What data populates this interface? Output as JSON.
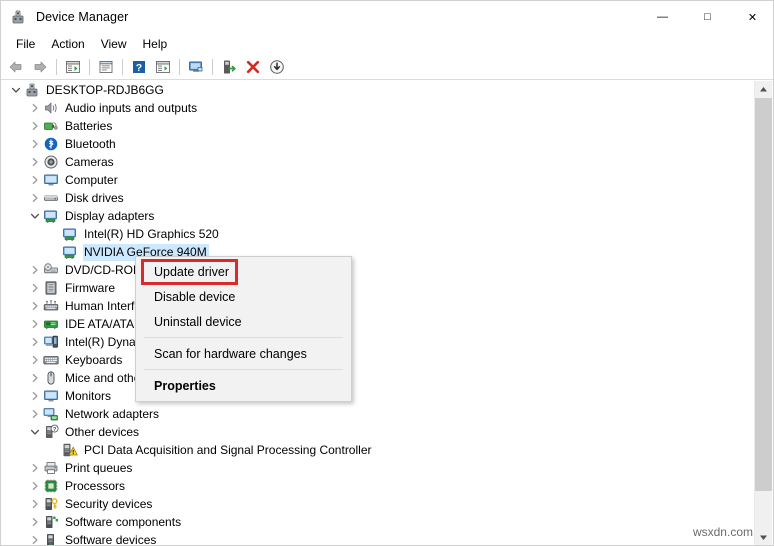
{
  "window": {
    "title": "Device Manager",
    "icon": "device-manager-icon",
    "controls": {
      "minimize": "—",
      "maximize": "□",
      "close": "✕"
    }
  },
  "menubar": {
    "items": [
      {
        "label": "File",
        "name": "menu-file"
      },
      {
        "label": "Action",
        "name": "menu-action"
      },
      {
        "label": "View",
        "name": "menu-view"
      },
      {
        "label": "Help",
        "name": "menu-help"
      }
    ]
  },
  "toolbar": {
    "buttons": [
      {
        "name": "back-icon",
        "tip": "Back"
      },
      {
        "name": "forward-icon",
        "tip": "Forward"
      },
      {
        "sep": true
      },
      {
        "name": "show-hide-console-tree-icon",
        "tip": "Show/Hide Console Tree"
      },
      {
        "sep": true
      },
      {
        "name": "properties-icon",
        "tip": "Properties"
      },
      {
        "sep": true
      },
      {
        "name": "help-icon",
        "tip": "Help"
      },
      {
        "name": "update-driver-icon",
        "tip": "Update driver"
      },
      {
        "sep": true
      },
      {
        "name": "scan-for-hardware-changes-icon",
        "tip": "Scan for hardware changes"
      },
      {
        "sep": true
      },
      {
        "name": "enable-device-icon",
        "tip": "Enable device"
      },
      {
        "name": "uninstall-device-icon",
        "tip": "Uninstall device"
      },
      {
        "name": "install-legacy-hardware-icon",
        "tip": "Add legacy hardware"
      }
    ]
  },
  "tree": {
    "rows": [
      {
        "label": "DESKTOP-RDJB6GG",
        "indent": 0,
        "state": "expanded",
        "icon": "computer-root-icon",
        "selected": false
      },
      {
        "label": "Audio inputs and outputs",
        "indent": 1,
        "state": "collapsed",
        "icon": "speaker-icon",
        "selected": false
      },
      {
        "label": "Batteries",
        "indent": 1,
        "state": "collapsed",
        "icon": "battery-icon",
        "selected": false
      },
      {
        "label": "Bluetooth",
        "indent": 1,
        "state": "collapsed",
        "icon": "bluetooth-icon",
        "selected": false
      },
      {
        "label": "Cameras",
        "indent": 1,
        "state": "collapsed",
        "icon": "camera-icon",
        "selected": false
      },
      {
        "label": "Computer",
        "indent": 1,
        "state": "collapsed",
        "icon": "monitor-icon",
        "selected": false
      },
      {
        "label": "Disk drives",
        "indent": 1,
        "state": "collapsed",
        "icon": "disk-drive-icon",
        "selected": false
      },
      {
        "label": "Display adapters",
        "indent": 1,
        "state": "expanded",
        "icon": "display-adapter-icon",
        "selected": false
      },
      {
        "label": "Intel(R) HD Graphics 520",
        "indent": 2,
        "state": "leaf",
        "icon": "display-adapter-icon",
        "selected": false
      },
      {
        "label": "NVIDIA GeForce 940M",
        "indent": 2,
        "state": "leaf",
        "icon": "display-adapter-icon",
        "selected": true
      },
      {
        "label": "DVD/CD-ROM drives",
        "indent": 1,
        "state": "collapsed",
        "icon": "dvd-drive-icon",
        "selected": false
      },
      {
        "label": "Firmware",
        "indent": 1,
        "state": "collapsed",
        "icon": "firmware-icon",
        "selected": false
      },
      {
        "label": "Human Interface Devices",
        "indent": 1,
        "state": "collapsed",
        "icon": "hid-icon",
        "selected": false
      },
      {
        "label": "IDE ATA/ATAPI controllers",
        "indent": 1,
        "state": "collapsed",
        "icon": "ide-controller-icon",
        "selected": false
      },
      {
        "label": "Intel(R) Dynamic Platform and Thermal Framework",
        "indent": 1,
        "state": "collapsed",
        "icon": "intel-platform-icon",
        "selected": false
      },
      {
        "label": "Keyboards",
        "indent": 1,
        "state": "collapsed",
        "icon": "keyboard-icon",
        "selected": false
      },
      {
        "label": "Mice and other pointing devices",
        "indent": 1,
        "state": "collapsed",
        "icon": "mouse-icon",
        "selected": false
      },
      {
        "label": "Monitors",
        "indent": 1,
        "state": "collapsed",
        "icon": "monitor-icon",
        "selected": false
      },
      {
        "label": "Network adapters",
        "indent": 1,
        "state": "collapsed",
        "icon": "network-adapter-icon",
        "selected": false
      },
      {
        "label": "Other devices",
        "indent": 1,
        "state": "expanded",
        "icon": "other-device-icon",
        "selected": false
      },
      {
        "label": "PCI Data Acquisition and Signal Processing Controller",
        "indent": 2,
        "state": "leaf",
        "icon": "warning-device-icon",
        "selected": false
      },
      {
        "label": "Print queues",
        "indent": 1,
        "state": "collapsed",
        "icon": "printer-icon",
        "selected": false
      },
      {
        "label": "Processors",
        "indent": 1,
        "state": "collapsed",
        "icon": "processor-icon",
        "selected": false
      },
      {
        "label": "Security devices",
        "indent": 1,
        "state": "collapsed",
        "icon": "security-device-icon",
        "selected": false
      },
      {
        "label": "Software components",
        "indent": 1,
        "state": "collapsed",
        "icon": "software-component-icon",
        "selected": false
      },
      {
        "label": "Software devices",
        "indent": 1,
        "state": "collapsed",
        "icon": "software-device-icon",
        "selected": false
      }
    ]
  },
  "context_menu": {
    "items": [
      {
        "label": "Update driver",
        "bold": false,
        "highlighted": true
      },
      {
        "label": "Disable device",
        "bold": false,
        "highlighted": false
      },
      {
        "label": "Uninstall device",
        "bold": false,
        "highlighted": false
      },
      {
        "separator": true
      },
      {
        "label": "Scan for hardware changes",
        "bold": false,
        "highlighted": false
      },
      {
        "separator": true
      },
      {
        "label": "Properties",
        "bold": true,
        "highlighted": false
      }
    ],
    "highlight_color": "#d92b2b"
  },
  "scrollbar": {
    "up_arrow": "▲",
    "down_arrow": "▼"
  },
  "watermark": {
    "text": "wsxdn.com"
  },
  "colors": {
    "selection": "#cce8ff",
    "menu_bg": "#f2f2f2",
    "highlight": "#d92b2b",
    "scrollbar_thumb": "#cdcdcd"
  }
}
